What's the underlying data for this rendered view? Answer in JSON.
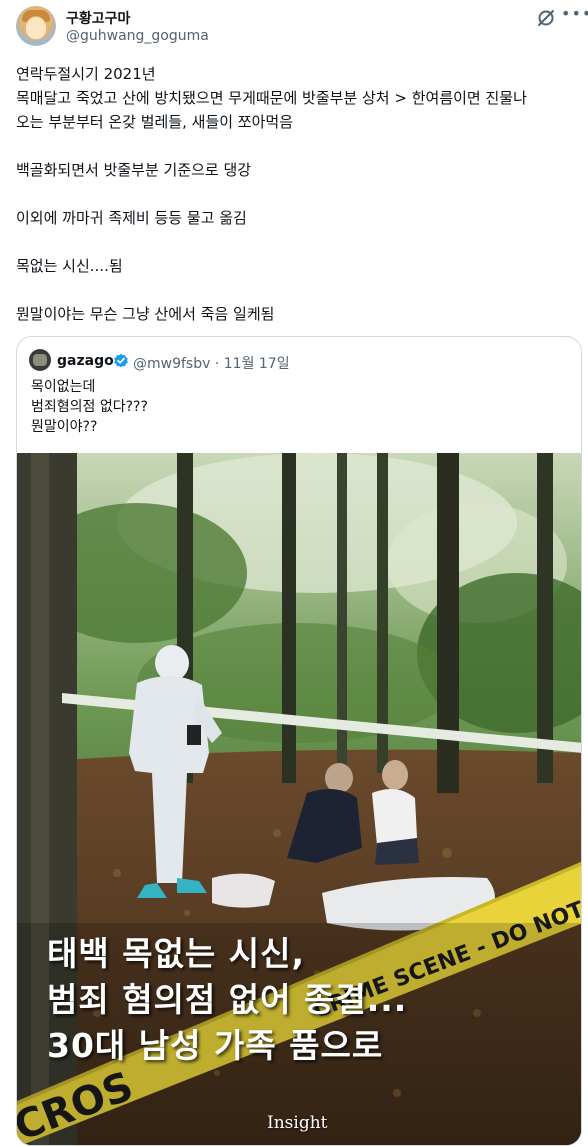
{
  "author": {
    "name": "구황고구마",
    "handle": "@guhwang_goguma"
  },
  "icons": {
    "grok": "grok-icon",
    "more": "more-icon",
    "verified": "verified-badge-icon"
  },
  "post": {
    "lines": [
      "연락두절시기 2021년",
      "목매달고 죽었고 산에 방치됐으면 무게때문에 밧줄부분 상처 > 한여름이면 진물나",
      "오는 부분부터 온갖 벌레들, 새들이 쪼아먹음",
      "백골화되면서 밧줄부분 기준으로 댕강",
      "이외에 까마귀 족제비 등등 물고 옮김",
      "목없는 시신....됨",
      "뭔말이야는 무슨 그냥 산에서 죽음 일케됨"
    ]
  },
  "quote": {
    "name": "gazago",
    "handle": "@mw9fsbv",
    "separator": "·",
    "date": "11월 17일",
    "lines": [
      "목이없는데",
      "범죄혐의점 없다???",
      "뭔말이야??"
    ],
    "media": {
      "headline_lines": [
        "태백 목없는 시신,",
        "범죄 혐의점 없어 종결...",
        "30대 남성 가족 품으로"
      ],
      "tape_text": "CRIME SCENE - DO NOT CROSS",
      "tape_text_left": "CROS",
      "watermark": "Insight"
    }
  },
  "colors": {
    "text_primary": "#0f1419",
    "text_secondary": "#536471",
    "verified_blue": "#1d9bf0",
    "border": "#cfd9de",
    "tape_yellow": "#e8d43a"
  }
}
